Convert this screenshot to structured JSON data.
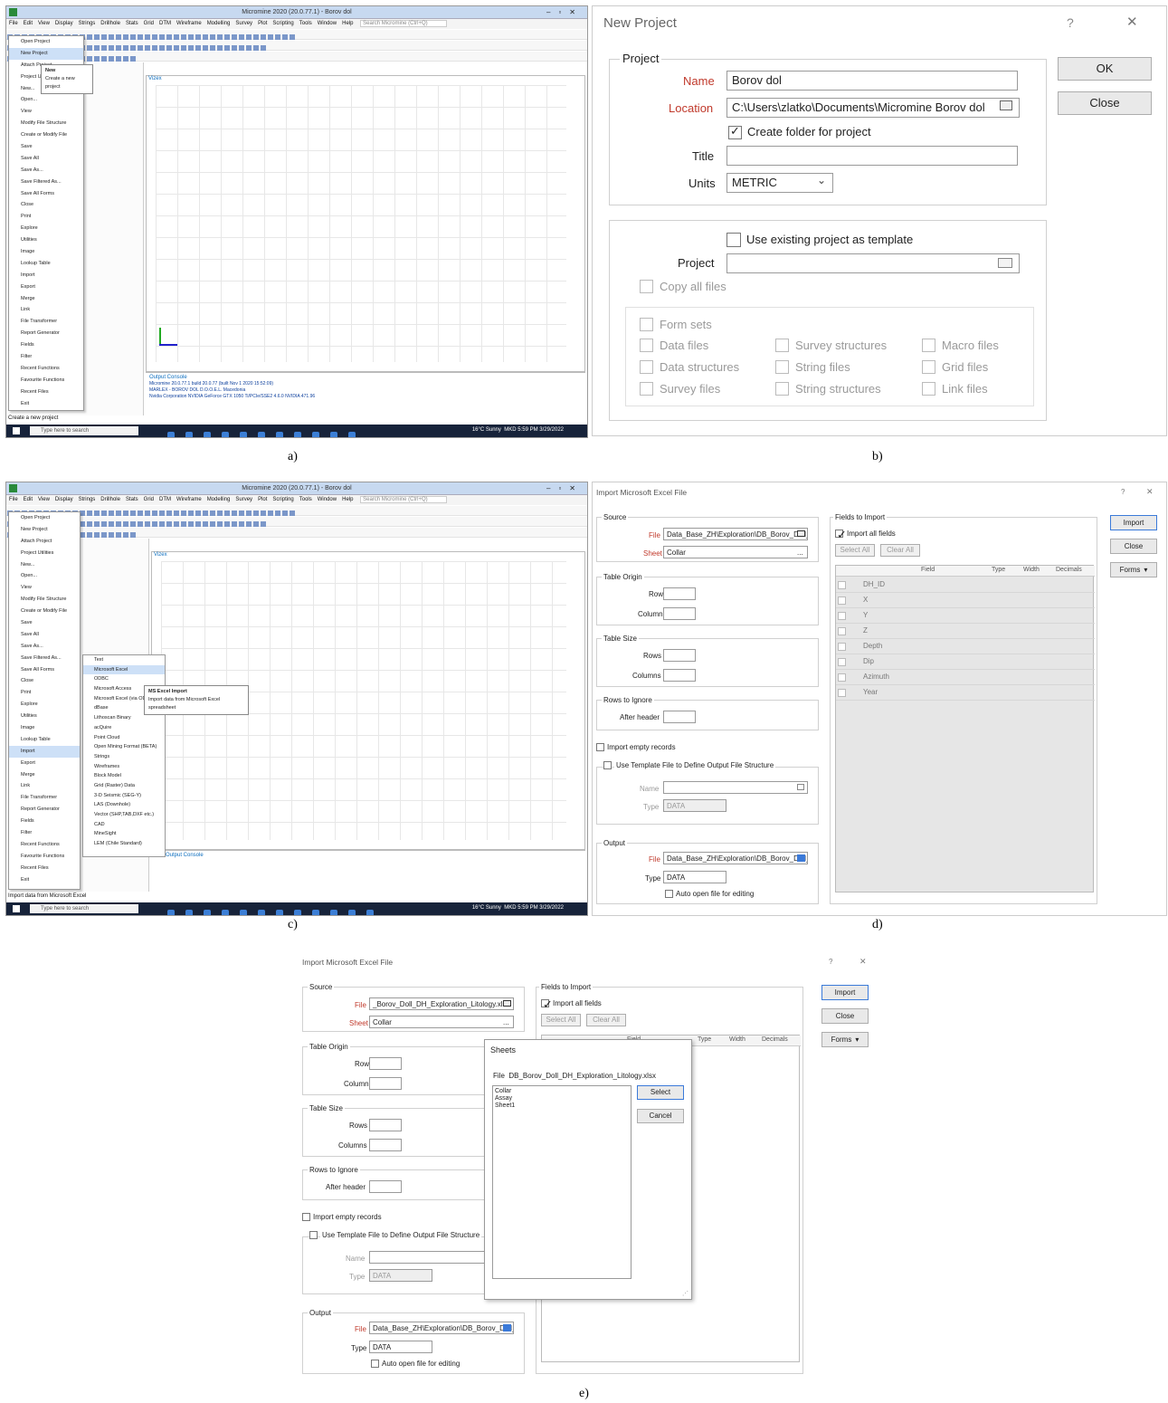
{
  "captions": [
    "a)",
    "b)",
    "c)",
    "d)",
    "e)"
  ],
  "app": {
    "title_a": "Micromine 2020 (20.0.77.1) - Borov dol",
    "title_c": "Micromine 2020 (20.0.77.1) - Borov dol",
    "menu": [
      "File",
      "Edit",
      "View",
      "Display",
      "Strings",
      "Drillhole",
      "Stats",
      "Grid",
      "DTM",
      "Wireframe",
      "Modelling",
      "Survey",
      "Plot",
      "Scripting",
      "Tools",
      "Window",
      "Help"
    ],
    "search_placeholder": "Search Micromine (Ctrl+Q)",
    "view_tab": "Vizex",
    "output_console_title": "Output Console",
    "console_lines": [
      "Micromine 20.0.77.1 build 20.0.77 (built Nov 1 2020 15:52:09)",
      "MARLEX - BOROV DOL D.O.O.E.L. Macedonia",
      "Nvidia Corporation NVIDIA GeForce GTX 1050 Ti/PCIe/SSE2 4.6.0 NVIDIA 471.96"
    ],
    "taskbar_search": "Type here to search",
    "weather": "16°C Sunny",
    "time": "5:59 PM",
    "date": "3/29/2022",
    "lang": "MKD",
    "status_a": "Create a new project",
    "status_c": "Import data from Microsoft Excel"
  },
  "file_menu": [
    "Open Project",
    "New Project",
    "Attach Project",
    "Project Utilities",
    "New...",
    "Open...",
    "View",
    "Modify File Structure",
    "Create or Modify File",
    "Save",
    "Save All",
    "Save As...",
    "Save Filtered As...",
    "Save All Forms",
    "Close",
    "Print",
    "Explore",
    "Utilities",
    "Image",
    "Lookup Table",
    "Import",
    "Export",
    "Merge",
    "Link",
    "File Transformer",
    "Report Generator",
    "Fields",
    "Filter",
    "Recent Functions",
    "Favourite Functions",
    "Recent Files",
    "Exit"
  ],
  "new_tooltip": {
    "title": "New",
    "desc": "Create a new project"
  },
  "import_submenu": [
    "Text",
    "Microsoft Excel",
    "ODBC",
    "Microsoft Access",
    "Microsoft Excel (via ODBC)",
    "dBase",
    "Lithoscan Binary",
    "acQuire",
    "Point Cloud",
    "Open Mining Format (BETA)",
    "Strings",
    "Wireframes",
    "Block Model",
    "Grid (Raster) Data",
    "3-D Seismic (SEG-Y)",
    "LAS (Downhole)",
    "Vector (SHP,TAB,DXF etc.)",
    "CAD",
    "MineSight",
    "LEM (Chile Standard)"
  ],
  "excel_tooltip": {
    "title": "MS Excel Import",
    "desc": "Import data from Microsoft Excel spreadsheet"
  },
  "new_project": {
    "title": "New Project",
    "help": "?",
    "close_x": "✕",
    "group_project": "Project",
    "name_label": "Name",
    "name_value": "Borov dol",
    "location_label": "Location",
    "location_value": "C:\\Users\\zlatko\\Documents\\Micromine Borov dol",
    "create_folder": "Create folder for project",
    "title_label": "Title",
    "title_value": "",
    "units_label": "Units",
    "units_value": "METRIC",
    "ok": "OK",
    "close": "Close",
    "use_template": "Use existing project as template",
    "project_label": "Project",
    "copy_all": "Copy all files",
    "form_sets": "Form sets",
    "data_files": "Data files",
    "survey_structures": "Survey structures",
    "macro_files": "Macro files",
    "data_structures": "Data structures",
    "string_files": "String files",
    "grid_files": "Grid files",
    "survey_files": "Survey files",
    "string_structures": "String structures",
    "link_files": "Link files"
  },
  "import_excel": {
    "title": "Import Microsoft Excel File",
    "help": "?",
    "close_x": "✕",
    "source": "Source",
    "file_label": "File",
    "file_value_d": "Data_Base_ZH\\Exploration\\DB_Borov_Doll_DH_Exploration_Litology.xlsx",
    "file_value_e": "_Borov_Doll_DH_Exploration_Litology.xlsx",
    "sheet_label": "Sheet",
    "sheet_value": "Collar",
    "ellipsis": "...",
    "table_origin": "Table Origin",
    "row": "Row",
    "column": "Column",
    "table_size": "Table Size",
    "rows": "Rows",
    "columns": "Columns",
    "rows_ignore": "Rows to Ignore",
    "after_header": "After header",
    "import_empty": "Import empty records",
    "use_template": "Use Template File to Define Output File Structure",
    "name": "Name",
    "type": "Type",
    "type_value": "DATA",
    "output": "Output",
    "out_file_value": "Data_Base_ZH\\Exploration\\DB_Borov_Doll_DH",
    "out_type_value": "DATA",
    "auto_open": "Auto open file for editing",
    "fields_to_import": "Fields to Import",
    "import_all_fields": "Import all fields",
    "select_all": "Select All",
    "clear_all": "Clear All",
    "col_field": "Field",
    "col_type": "Type",
    "col_width": "Width",
    "col_decimals": "Decimals",
    "fields": [
      "DH_ID",
      "X",
      "Y",
      "Z",
      "Depth",
      "Dip",
      "Azimuth",
      "Year"
    ],
    "import_btn": "Import",
    "close_btn": "Close",
    "forms_btn": "Forms"
  },
  "sheets_dialog": {
    "title": "Sheets",
    "file_label": "File",
    "file_value": "DB_Borov_Doll_DH_Exploration_Litology.xlsx",
    "sheets": [
      "Collar",
      "Assay",
      "Sheet1"
    ],
    "select": "Select",
    "cancel": "Cancel"
  },
  "colors": {
    "accent": "#0d6ebf",
    "required_label": "#c0392b",
    "taskbar": "#17233a",
    "menu_highlight": "#cde0f7"
  }
}
